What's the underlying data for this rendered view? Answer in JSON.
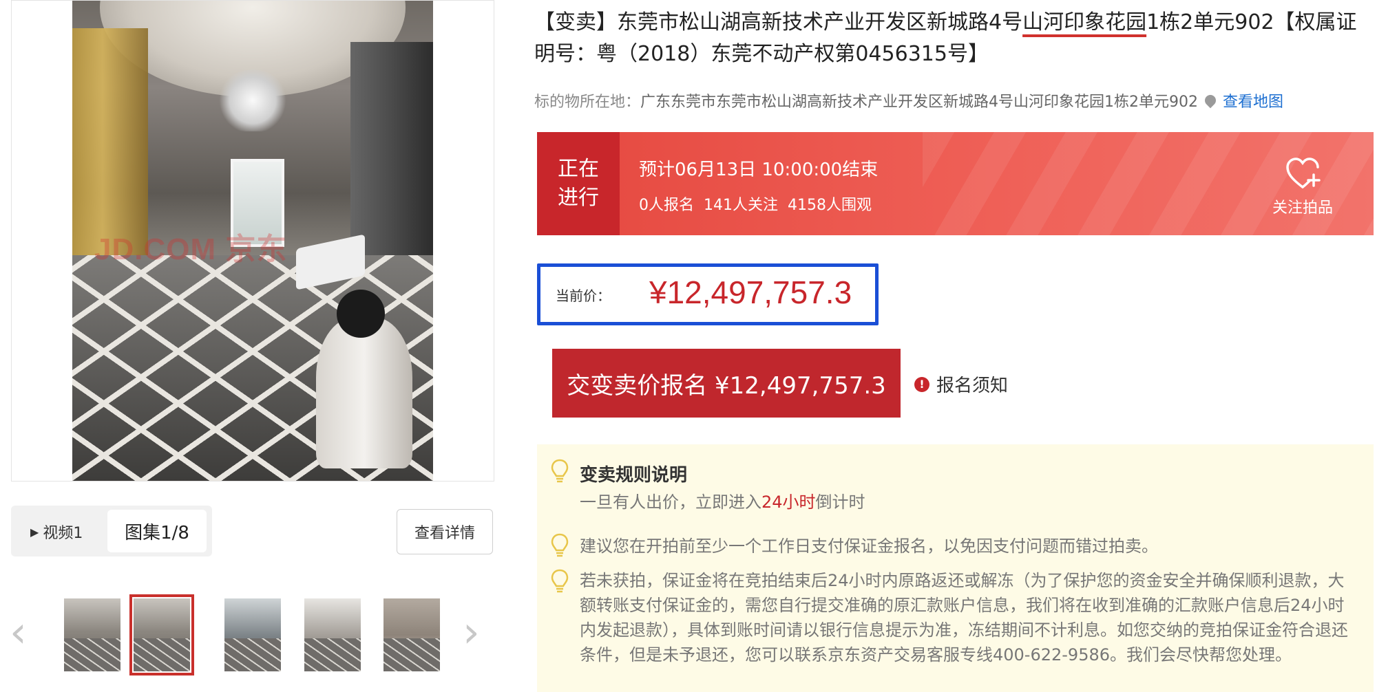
{
  "gallery": {
    "watermark": "JD.COM 京东",
    "tab_video": "视频1",
    "tab_gallery": "图集1/8",
    "detail_button": "查看详情",
    "thumb_count": 5,
    "selected_thumb": 2
  },
  "listing": {
    "title_pre": "【变卖】东莞市松山湖高新技术产业开发区新城路4号",
    "title_highlight": "山河印象花园",
    "title_post": "1栋2单元902【权属证明号：粤（2018）东莞不动产权第0456315号】",
    "location_label": "标的物所在地：",
    "location_value": "广东东莞市东莞市松山湖高新技术产业开发区新城路4号山河印象花园1栋2单元902",
    "map_link": "查看地图"
  },
  "auction": {
    "status": [
      "正在",
      "进行"
    ],
    "end_time": "预计06月13日 10:00:00结束",
    "signups": "0人报名",
    "followers": "141人关注",
    "viewers": "4158人围观",
    "follow_label": "关注拍品"
  },
  "price": {
    "label": "当前价：",
    "value": "¥12,497,757.3",
    "signup_button": "交变卖价报名 ¥12,497,757.3",
    "notice_icon": "!",
    "notice": "报名须知"
  },
  "rules": {
    "title": "变卖规则说明",
    "line1_pre": "一旦有人出价，立即进入",
    "line1_em": "24小时",
    "line1_post": "倒计时",
    "line2": "建议您在开拍前至少一个工作日支付保证金报名，以免因支付问题而错过拍卖。",
    "line3": "若未获拍，保证金将在竞拍结束后24小时内原路返还或解冻（为了保护您的资金安全并确保顺利退款，大额转账支付保证金的，需您自行提交准确的原汇款账户信息，我们将在收到准确的汇款账户信息后24小时内发起退款），具体到账时间请以银行信息提示为准，冻结期间不计利息。如您交纳的竞拍保证金符合退还条件，但是未予退还，您可以联系京东资产交易客服专线400-622-9586。我们会尽快帮您处理。"
  },
  "colors": {
    "brand_red": "#c8262b",
    "highlight_blue": "#1a4fd6",
    "link_blue": "#1d6fd1",
    "notice_bg": "#fefbe6"
  }
}
